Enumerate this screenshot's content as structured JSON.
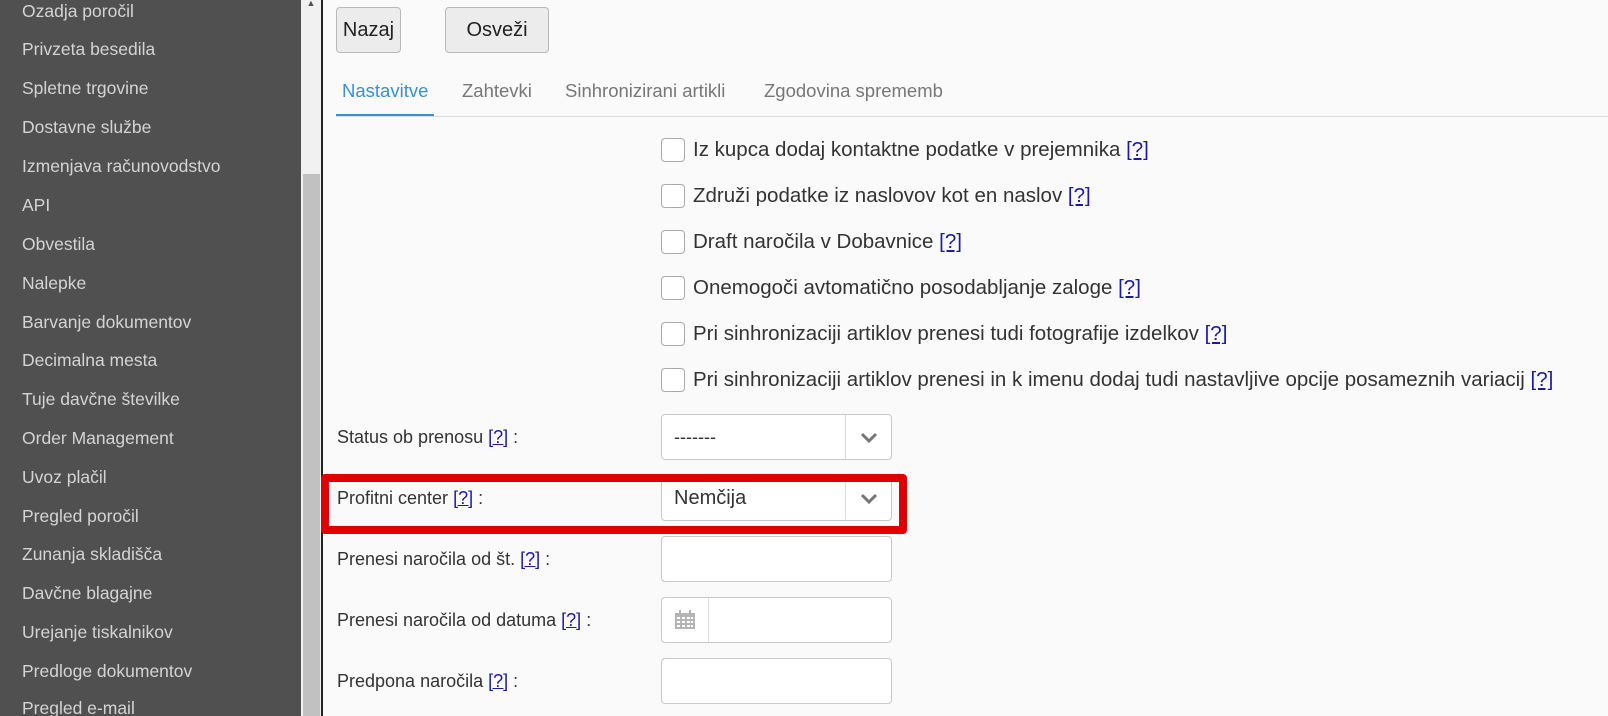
{
  "sidebar": {
    "items": [
      "Ozadja poročil",
      "Privzeta besedila",
      "Spletne trgovine",
      "Dostavne službe",
      "Izmenjava računovodstvo",
      "API",
      "Obvestila",
      "Nalepke",
      "Barvanje dokumentov",
      "Decimalna mesta",
      "Tuje davčne številke",
      "Order Management",
      "Uvoz plačil",
      "Pregled poročil",
      "Zunanja skladišča",
      "Davčne blagajne",
      "Urejanje tiskalnikov",
      "Predloge dokumentov",
      "Pregled e-mail"
    ]
  },
  "toolbar": {
    "back_label": "Nazaj",
    "refresh_label": "Osveži"
  },
  "tabs": [
    {
      "label": "Nastavitve",
      "active": true
    },
    {
      "label": "Zahtevki",
      "active": false
    },
    {
      "label": "Sinhronizirani artikli",
      "active": false
    },
    {
      "label": "Zgodovina sprememb",
      "active": false
    }
  ],
  "help_text": "[?]",
  "checkboxes": [
    {
      "label": "Iz kupca dodaj kontaktne podatke v prejemnika",
      "checked": false
    },
    {
      "label": "Združi podatke iz naslovov kot en naslov",
      "checked": false
    },
    {
      "label": "Draft naročila v Dobavnice",
      "checked": false
    },
    {
      "label": "Onemogoči avtomatično posodabljanje zaloge",
      "checked": false
    },
    {
      "label": "Pri sinhronizaciji artiklov prenesi tudi fotografije izdelkov",
      "checked": false
    },
    {
      "label": "Pri sinhronizaciji artiklov prenesi in k imenu dodaj tudi nastavljive opcije posameznih variacij",
      "checked": false
    }
  ],
  "form": {
    "status": {
      "label": "Status ob prenosu",
      "value": "-------"
    },
    "profit_center": {
      "label": "Profitni center",
      "value": "Nemčija"
    },
    "from_number": {
      "label": "Prenesi naročila od št.",
      "value": ""
    },
    "from_date": {
      "label": "Prenesi naročila od datuma",
      "value": ""
    },
    "prefix": {
      "label": "Predpona naročila",
      "value": ""
    },
    "colon": ":"
  },
  "colors": {
    "accent": "#3a8fd6",
    "highlight": "#e00000",
    "sidebar_bg": "#505050"
  }
}
